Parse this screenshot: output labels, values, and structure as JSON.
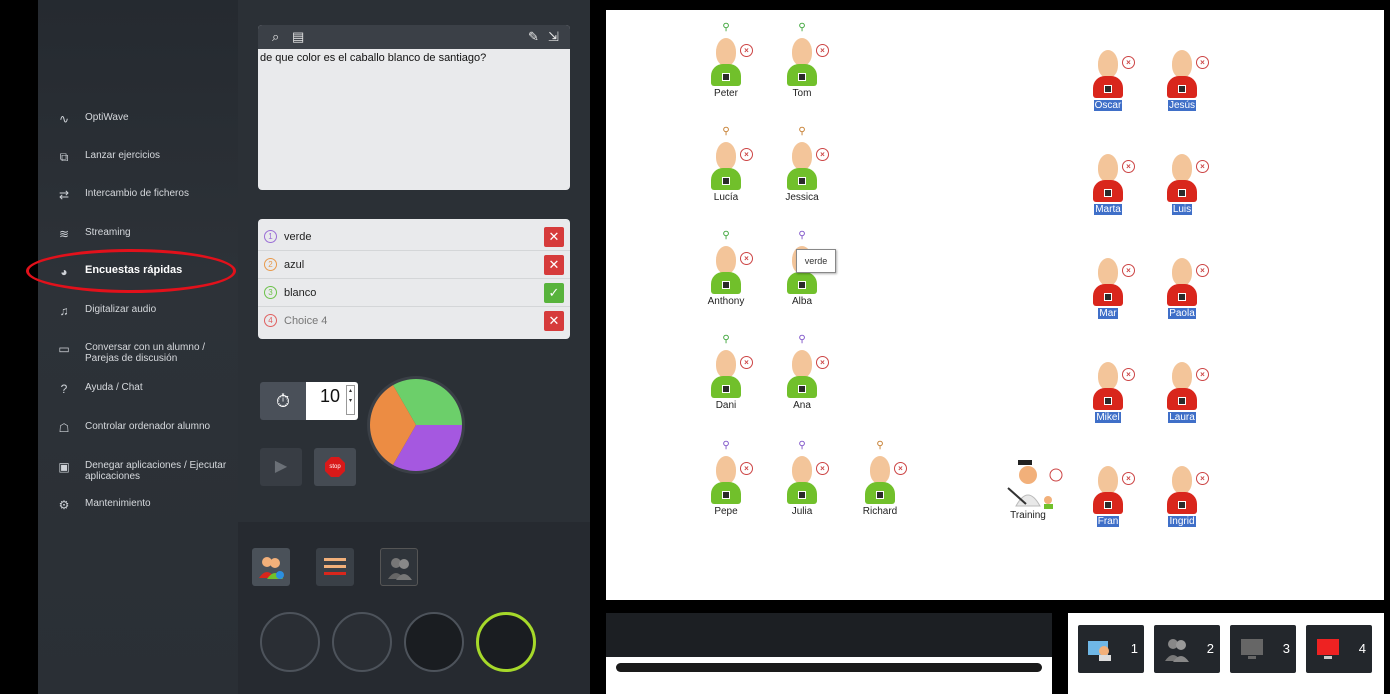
{
  "sidebar": {
    "items": [
      {
        "icon": "waveform-icon",
        "label": "OptiWave"
      },
      {
        "icon": "copy-icon",
        "label": "Lanzar ejercicios"
      },
      {
        "icon": "exchange-arrows-icon",
        "label": "Intercambio de ficheros"
      },
      {
        "icon": "wifi-icon",
        "label": "Streaming"
      },
      {
        "icon": "survey-icon",
        "label": "Encuestas rápidas"
      },
      {
        "icon": "headset-icon",
        "label": "Digitalizar audio"
      },
      {
        "icon": "chat-icon",
        "label": "Conversar con un alumno / Parejas de discusión"
      },
      {
        "icon": "help-icon",
        "label": "Ayuda / Chat"
      },
      {
        "icon": "remote-user-icon",
        "label": "Controlar ordenador alumno"
      },
      {
        "icon": "app-block-icon",
        "label": "Denegar aplicaciones / Ejecutar aplicaciones"
      },
      {
        "icon": "maintenance-icon",
        "label": "Mantenimiento"
      }
    ],
    "active_item": "Encuestas rápidas",
    "highlight_color": "#e2111b"
  },
  "survey": {
    "question": "de que color es el caballo blanco de santiago?",
    "answers": [
      {
        "num": "1",
        "label": "verde",
        "correct": false,
        "color": "#9b6fd6"
      },
      {
        "num": "2",
        "label": "azul",
        "correct": false,
        "color": "#e89a4c"
      },
      {
        "num": "3",
        "label": "blanco",
        "correct": true,
        "color": "#6cc24a"
      },
      {
        "num": "4",
        "label": "Choice 4",
        "correct": false,
        "color": "#e06060"
      }
    ],
    "timer_value": "10",
    "stop_label": "stop"
  },
  "chart_data": {
    "type": "pie",
    "categories": [
      "green",
      "purple",
      "orange"
    ],
    "values": [
      1,
      1,
      1
    ],
    "colors": [
      "#6ccf6a",
      "#a558e0",
      "#ec8c43"
    ]
  },
  "classroom": {
    "students": [
      {
        "name": "Peter",
        "status": "green",
        "hand": "#3aa336"
      },
      {
        "name": "Tom",
        "status": "green",
        "hand": "#3aa336"
      },
      {
        "name": "Lucía",
        "status": "green",
        "hand": "#c47a2a"
      },
      {
        "name": "Jessica",
        "status": "green",
        "hand": "#c47a2a"
      },
      {
        "name": "Anthony",
        "status": "green",
        "hand": "#3aa336"
      },
      {
        "name": "Alba",
        "status": "green",
        "hand": "#7b4fc7"
      },
      {
        "name": "Dani",
        "status": "green",
        "hand": "#3aa336"
      },
      {
        "name": "Ana",
        "status": "green",
        "hand": "#7b4fc7"
      },
      {
        "name": "Pepe",
        "status": "green",
        "hand": "#7b4fc7"
      },
      {
        "name": "Julia",
        "status": "green",
        "hand": "#7b4fc7"
      },
      {
        "name": "Richard",
        "status": "green",
        "hand": "#c47a2a"
      },
      {
        "name": "Oscar",
        "status": "red"
      },
      {
        "name": "Jesús",
        "status": "red"
      },
      {
        "name": "Marta",
        "status": "red"
      },
      {
        "name": "Luis",
        "status": "red"
      },
      {
        "name": "Mar",
        "status": "red"
      },
      {
        "name": "Paola",
        "status": "red"
      },
      {
        "name": "Mikel",
        "status": "red"
      },
      {
        "name": "Laura",
        "status": "red"
      },
      {
        "name": "Fran",
        "status": "red"
      },
      {
        "name": "Ingrid",
        "status": "red"
      }
    ],
    "tooltip": "verde",
    "teacher_label": "Training"
  },
  "groups": {
    "labels": [
      "1",
      "2",
      "3",
      "4"
    ]
  }
}
